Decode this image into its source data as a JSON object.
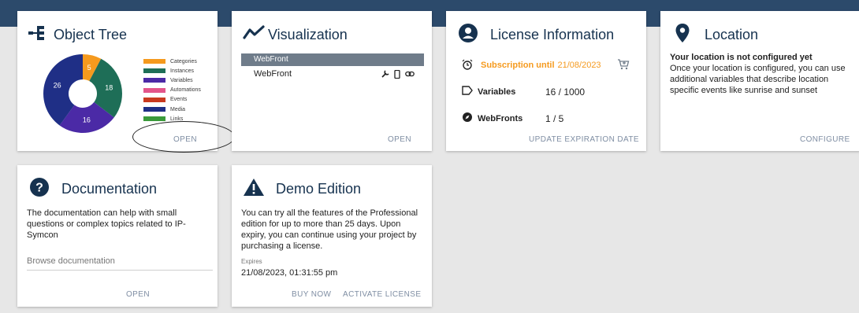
{
  "object_tree": {
    "title": "Object Tree",
    "icon": "object-tree-icon",
    "open_label": "OPEN",
    "chart_data": {
      "type": "pie",
      "slices": [
        {
          "label": "Categories",
          "value": 5,
          "color": "#f59a1e"
        },
        {
          "label": "Instances",
          "value": 18,
          "color": "#1e6e57"
        },
        {
          "label": "Variables",
          "value": 16,
          "color": "#4b2aa6"
        },
        {
          "label": "Automations",
          "value": 0,
          "color": "#e3558a"
        },
        {
          "label": "Events",
          "value": 0,
          "color": "#c93a1f"
        },
        {
          "label": "Media",
          "value": 26,
          "color": "#1f2f86"
        },
        {
          "label": "Links",
          "value": 0,
          "color": "#3a9a3a"
        }
      ],
      "legend": [
        "Categories",
        "Instances",
        "Variables",
        "Automations",
        "Events",
        "Media",
        "Links"
      ],
      "donut": true
    }
  },
  "visualization": {
    "title": "Visualization",
    "icon": "chart-line-icon",
    "header_row": "WebFront",
    "rows": [
      {
        "name": "WebFront"
      }
    ],
    "open_label": "OPEN"
  },
  "license": {
    "title": "License Information",
    "icon": "account-circle-icon",
    "subscription_label": "Subscription until",
    "subscription_date": "21/08/2023",
    "subscription_color": "#f59a1e",
    "variables_label": "Variables",
    "variables_value": "16 / 1000",
    "webfronts_label": "WebFronts",
    "webfronts_value": "1 / 5",
    "update_label": "UPDATE EXPIRATION DATE"
  },
  "location": {
    "title": "Location",
    "icon": "map-pin-icon",
    "heading": "Your location is not configured yet",
    "text": "Once your location is configured, you can use additional variables that describe location specific events like sunrise and sunset",
    "configure_label": "CONFIGURE"
  },
  "documentation": {
    "title": "Documentation",
    "icon": "help-circle-icon",
    "text": "The documentation can help with small questions or complex topics related to IP-Symcon",
    "browse_placeholder": "Browse documentation",
    "open_label": "OPEN"
  },
  "demo": {
    "title": "Demo Edition",
    "icon": "warning-icon",
    "text": "You can try all the features of the Professional edition for up to more than 25 days. Upon expiry, you can continue using your project by purchasing a license.",
    "expires_label": "Expires",
    "expires_value": "21/08/2023, 01:31:55 pm",
    "buy_label": "BUY NOW",
    "activate_label": "ACTIVATE LICENSE"
  }
}
